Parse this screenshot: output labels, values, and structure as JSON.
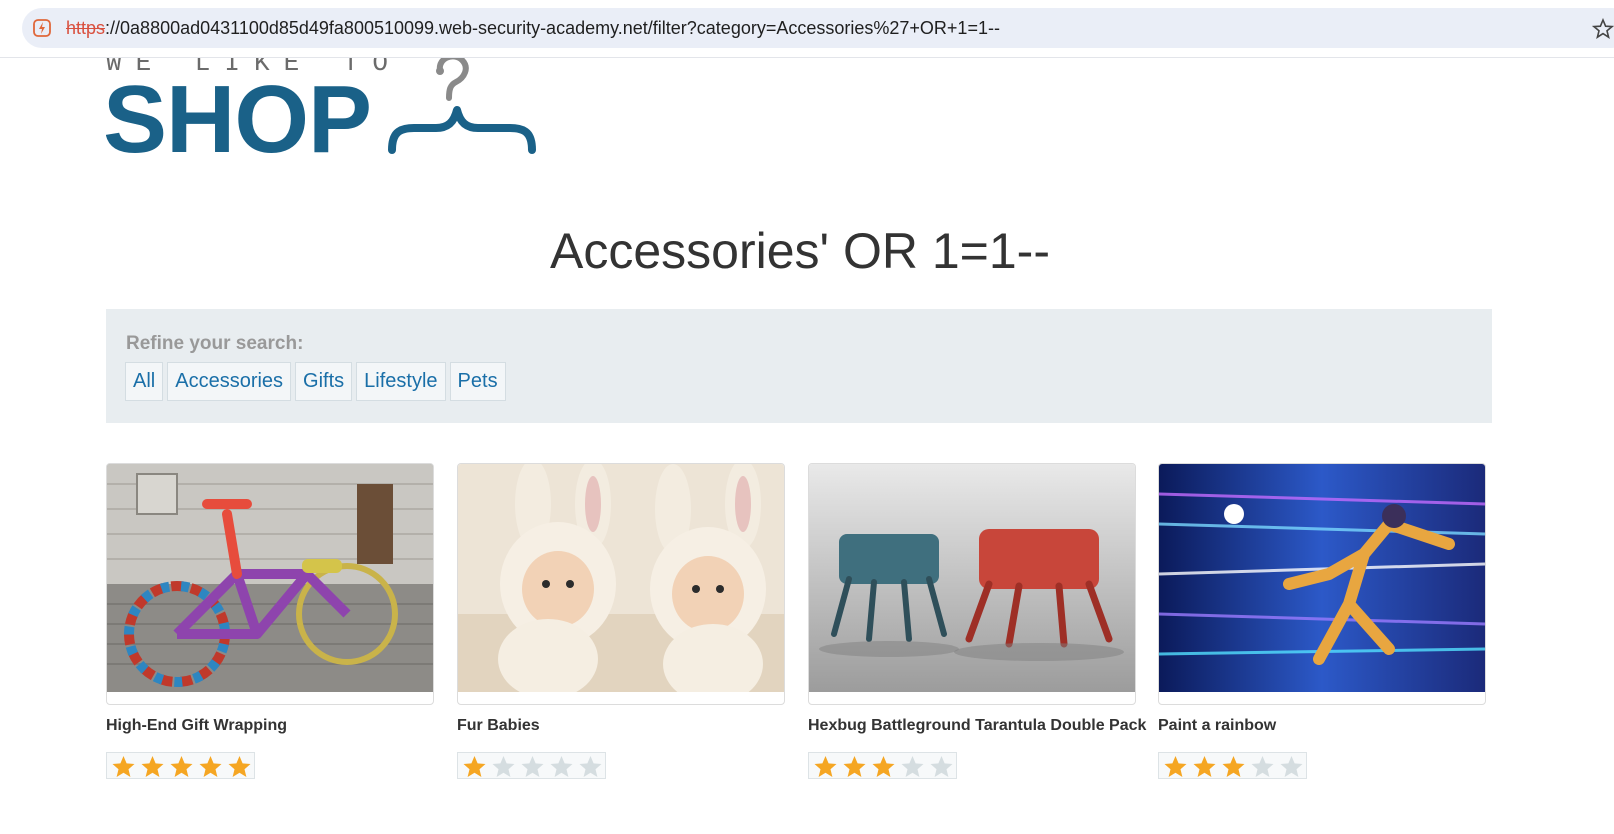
{
  "browser": {
    "url_scheme": "https",
    "url_rest": "://0a8800ad0431100d85d49fa800510099.web-security-academy.net/filter?category=Accessories%27+OR+1=1--"
  },
  "logo": {
    "tagline": "WE LIKE TO",
    "name": "SHOP"
  },
  "page": {
    "title": "Accessories' OR 1=1--"
  },
  "filters": {
    "label": "Refine your search:",
    "links": [
      "All",
      "Accessories",
      "Gifts",
      "Lifestyle",
      "Pets"
    ]
  },
  "products": [
    {
      "name": "High-End Gift Wrapping",
      "rating": 5,
      "image_icon": "knitted-bicycle-photo"
    },
    {
      "name": "Fur Babies",
      "rating": 1,
      "image_icon": "babies-in-bunny-hats-photo"
    },
    {
      "name": "Hexbug Battleground Tarantula Double Pack",
      "rating": 3,
      "image_icon": "robot-spiders-photo"
    },
    {
      "name": "Paint a rainbow",
      "rating": 3,
      "image_icon": "neon-runner-photo"
    }
  ],
  "colors": {
    "brand": "#1a6188",
    "link": "#1a6fa8",
    "star_on": "#f5a623",
    "star_off": "#d5dde0",
    "panel": "#e8edf0"
  }
}
